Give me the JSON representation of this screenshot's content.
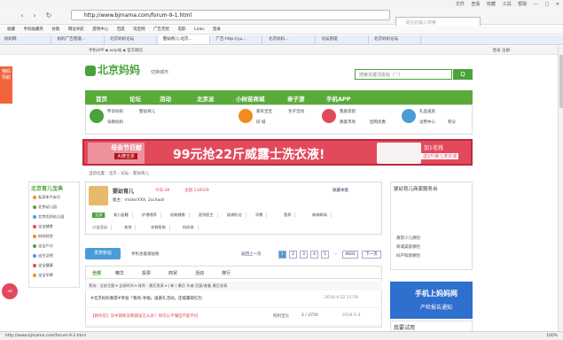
{
  "window": {
    "controls": [
      "文件",
      "查看",
      "收藏",
      "工具",
      "帮助"
    ],
    "min": "—",
    "max": "□",
    "close": "✕"
  },
  "nav": {
    "url": "http://www.bjmama.com/forum-9-1.html",
    "engine": "百度",
    "search_placeholder": "请在此输入搜索",
    "back": "‹",
    "fwd": "›",
    "refresh": "↻"
  },
  "favorites": [
    "收藏",
    "手机收藏夹",
    "谷歌",
    "网址导航",
    "游戏中心",
    "百度",
    "淘宝网",
    "广告无忧",
    "电影",
    "Links",
    "登录"
  ],
  "tabs": [
    "妈妈网",
    "妈妈广告管理...",
    "北京妈妈论坛",
    "婴幼育儿-北京...",
    "广告-http://yu...",
    "北京妈妈...",
    "论坛管理",
    "北京妈妈论坛"
  ],
  "topstrip": {
    "left": "手机APP ▪ wap站 ▪ 官方微信",
    "right": "登录  注册"
  },
  "site": {
    "logo": "北京妈妈",
    "city": "切换城市",
    "search_category": "帖子",
    "search_hint": "搜索关键词看帖（'·'）",
    "search_btn": "Q"
  },
  "mainnav": [
    "首页",
    "论坛",
    "活动",
    "北京派",
    "小树苗商城",
    "亲子游",
    "手机APP"
  ],
  "subnav": [
    {
      "label": "怀孕妈妈",
      "items": [
        "婴幼育儿",
        "早教妈妈"
      ]
    },
    {
      "label": "家有宝宝",
      "items": [
        "亲子活动",
        "同 城"
      ]
    },
    {
      "label": "我爱逛街",
      "items": [
        "跳蚤市场",
        "团购优惠"
      ]
    },
    {
      "label": "礼品道具",
      "items": [
        "试用中心",
        "积分"
      ]
    }
  ],
  "banner": {
    "tag": "母亲节巨献",
    "sub": "大牌五折",
    "headline": "99元抢22斤威露士洗衣液!",
    "right1": "加1毛钱",
    "right2": "送2斤婴儿洗衣液"
  },
  "crumb": "当前位置：北京 › 论坛 › 婴幼育儿",
  "leftside": {
    "title": "北京育儿宝典",
    "items": [
      "私家车平安乐",
      "北京幼儿园",
      "北京优质幼儿园",
      "宝宝辅食",
      "妈妈经验",
      "宝宝户口",
      "出生证明",
      "宝宝健康",
      "宝宝早教"
    ]
  },
  "leftad": "辣妈导航",
  "forum": {
    "name": "婴幼育儿",
    "today": "今日:48",
    "topics": "主题:138509",
    "mod_label": "版主：",
    "mods": "misterXXX, 2schaoli",
    "subscribe": "收藏本版",
    "tags": [
      "全部",
      "育儿秘籍",
      "护理喂养",
      "奶粉辅食",
      "医院医生",
      "疾病防治",
      "早教",
      "营养",
      "商城商场",
      "小宝活动",
      "其他",
      "求救帮助",
      "妈妈说"
    ]
  },
  "controls": {
    "new_post": "发表新帖",
    "mobile": "手机也能发帖啦",
    "prev": "返回上一页",
    "pages": [
      "1",
      "2",
      "3",
      "4",
      "5",
      "...",
      "4602"
    ],
    "next": "下一页"
  },
  "tabs_row": [
    "全部",
    "精华",
    "投票",
    "商贸",
    "活动",
    "排行"
  ],
  "filter": "筛选：全部主题 ▾   全部时间 ▾   排序：最后发表 ▾   |  新   |  最后    作者    回复/查看    最后发表",
  "rows": [
    {
      "title": "#北京妈妈春游#参加「春风·寻福」送豪礼活动，还能赢取红包",
      "author": "",
      "stats": "",
      "last": "2016-4-22 11:59"
    },
    {
      "title": "【教你答】孕中期和孕晚期该怎么办？你可以不懂但不能不问",
      "author": "阿利宝贝",
      "stats": "2 / 4750",
      "last": "2016-5-3"
    }
  ],
  "rightside": {
    "box_title": "婴幼育儿商家服务台",
    "items": [
      "悬赏少儿保险",
      "商城美容保险",
      "妇产科新保险"
    ],
    "ad": "手机上妈妈网",
    "ad_sub": "产检报告通知",
    "box2": "我要试用"
  },
  "status": {
    "url": "http://www.bjmama.com/forum-9-2.html",
    "zoom": "100%"
  }
}
